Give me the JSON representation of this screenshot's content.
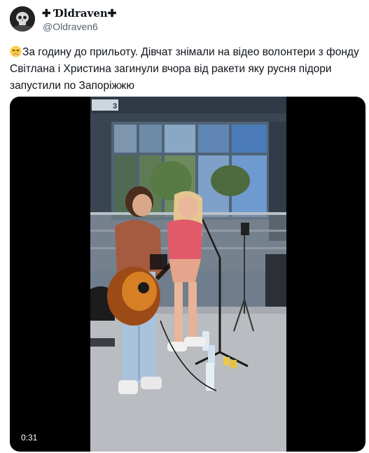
{
  "author": {
    "display_name": "✚ Ɗldraven✚",
    "handle": "@Oldraven6",
    "avatar_icon": "skull-avatar-icon"
  },
  "tweet": {
    "emoji": "tired-face-emoji",
    "lines": [
      "За годину до прильоту. Дівчат знімали на відео волонтери з фонду",
      "Світлана і Христина загинули вчора від ракети яку русня підори",
      "запустили по Запоріжжю"
    ]
  },
  "media": {
    "type": "video",
    "duration": "0:31",
    "sign_text": "3"
  }
}
